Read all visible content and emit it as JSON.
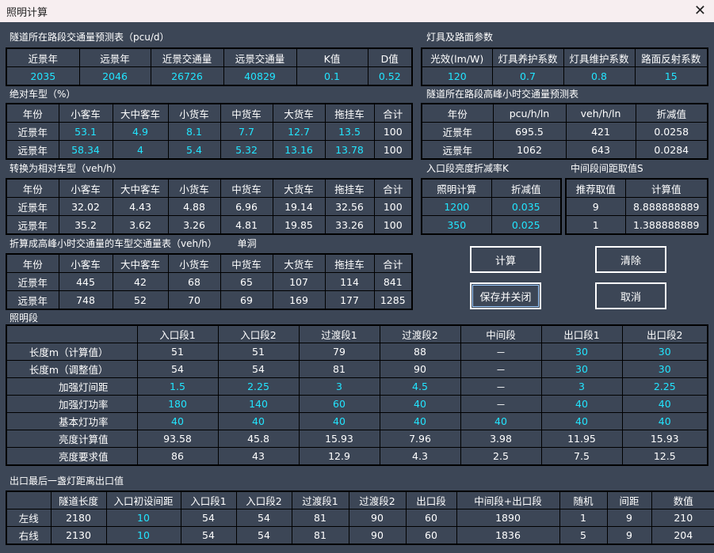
{
  "window": {
    "title": "照明计算"
  },
  "s1": {
    "title": "隧道所在路段交通量预测表（pcu/d）",
    "headers": [
      "近景年",
      "远景年",
      "近景交通量",
      "远景交通量",
      "K值",
      "D值"
    ],
    "row": [
      "2035",
      "2046",
      "26726",
      "40829",
      "0.1",
      "0.52"
    ]
  },
  "s2": {
    "title": "灯具及路面参数",
    "headers": [
      "光效(lm/W)",
      "灯具养护系数",
      "灯具维护系数",
      "路面反射系数"
    ],
    "row": [
      "120",
      "0.7",
      "0.8",
      "15"
    ]
  },
  "s3": {
    "title": "绝对车型（%）",
    "headers": [
      "年份",
      "小客车",
      "大中客车",
      "小货车",
      "中货车",
      "大货车",
      "拖挂车",
      "合计"
    ],
    "rows": [
      [
        "近景年",
        "53.1",
        "4.9",
        "8.1",
        "7.7",
        "12.7",
        "13.5",
        "100"
      ],
      [
        "远景年",
        "58.34",
        "4",
        "5.4",
        "5.32",
        "13.16",
        "13.78",
        "100"
      ]
    ]
  },
  "s4": {
    "title": "隧道所在路段高峰小时交通量预测表",
    "headers": [
      "年份",
      "pcu/h/ln",
      "veh/h/ln",
      "折减值"
    ],
    "rows": [
      [
        "近景年",
        "695.5",
        "421",
        "0.0258"
      ],
      [
        "远景年",
        "1062",
        "643",
        "0.0284"
      ]
    ]
  },
  "s5": {
    "title": "转换为相对车型（veh/h）",
    "headers": [
      "年份",
      "小客车",
      "大中客车",
      "小货车",
      "中货车",
      "大货车",
      "拖挂车",
      "合计"
    ],
    "rows": [
      [
        "近景年",
        "32.02",
        "4.43",
        "4.88",
        "6.96",
        "19.14",
        "32.56",
        "100"
      ],
      [
        "远景年",
        "35.2",
        "3.62",
        "3.26",
        "4.81",
        "19.85",
        "33.26",
        "100"
      ]
    ]
  },
  "s6": {
    "title": "入口段亮度折减率K",
    "headers": [
      "照明计算",
      "折减值"
    ],
    "rows": [
      [
        "1200",
        "0.035"
      ],
      [
        "350",
        "0.025"
      ]
    ]
  },
  "s7": {
    "title": "中间段间距取值S",
    "headers": [
      "推荐取值",
      "计算值"
    ],
    "rows": [
      [
        "9",
        "8.888888889"
      ],
      [
        "1",
        "1.388888889"
      ]
    ]
  },
  "s8": {
    "title": "折算成高峰小时交通量的车型交通量表（veh/h）",
    "note": "单洞",
    "headers": [
      "年份",
      "小客车",
      "大中客车",
      "小货车",
      "中货车",
      "大货车",
      "拖挂车",
      "合计"
    ],
    "rows": [
      [
        "近景年",
        "445",
        "42",
        "68",
        "65",
        "107",
        "114",
        "841"
      ],
      [
        "远景年",
        "748",
        "52",
        "70",
        "69",
        "169",
        "177",
        "1285"
      ]
    ]
  },
  "buttons": {
    "calc": "计算",
    "clear": "清除",
    "save_close": "保存并关闭",
    "cancel": "取消"
  },
  "s9": {
    "title": "照明段",
    "headers": [
      "",
      "入口段1",
      "入口段2",
      "过渡段1",
      "过渡段2",
      "中间段",
      "出口段1",
      "出口段2"
    ],
    "rows": [
      [
        "长度m（计算值）",
        "51",
        "51",
        "79",
        "88",
        "－",
        "30",
        "30"
      ],
      [
        "长度m（调整值）",
        "54",
        "54",
        "81",
        "90",
        "－",
        "30",
        "30"
      ],
      [
        "加强灯间距",
        "1.5",
        "2.25",
        "3",
        "4.5",
        "－",
        "3",
        "2.25"
      ],
      [
        "加强灯功率",
        "180",
        "140",
        "60",
        "40",
        "－",
        "40",
        "40"
      ],
      [
        "基本灯功率",
        "40",
        "40",
        "40",
        "40",
        "40",
        "40",
        "40"
      ],
      [
        "亮度计算值",
        "93.58",
        "45.8",
        "15.93",
        "7.96",
        "3.98",
        "11.95",
        "15.93"
      ],
      [
        "亮度要求值",
        "86",
        "43",
        "12.9",
        "4.3",
        "2.5",
        "7.5",
        "12.5"
      ]
    ]
  },
  "s10": {
    "title": "出口最后一盏灯距离出口值",
    "headers": [
      "",
      "隧道长度",
      "入口初设间距",
      "入口段1",
      "入口段2",
      "过渡段1",
      "过渡段2",
      "出口段",
      "中间段+出口段",
      "随机",
      "间距",
      "数值"
    ],
    "rows": [
      [
        "左线",
        "2180",
        "10",
        "54",
        "54",
        "81",
        "90",
        "60",
        "1890",
        "1",
        "9",
        "210"
      ],
      [
        "右线",
        "2130",
        "10",
        "54",
        "54",
        "81",
        "90",
        "60",
        "1836",
        "5",
        "9",
        "204"
      ]
    ]
  }
}
